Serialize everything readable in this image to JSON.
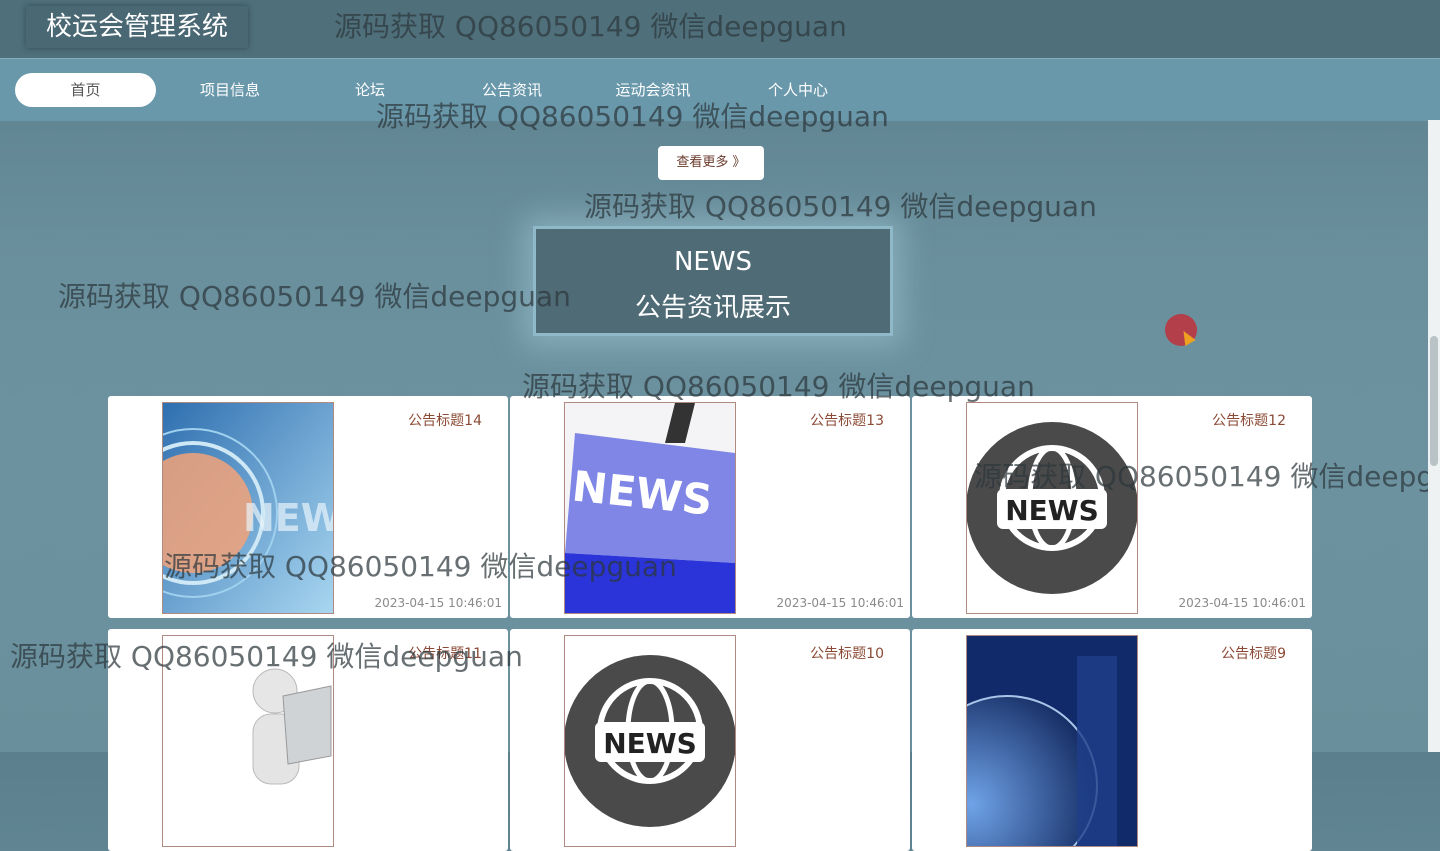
{
  "app": {
    "title": "校运会管理系统"
  },
  "nav": {
    "items": [
      {
        "label": "首页"
      },
      {
        "label": "项目信息"
      },
      {
        "label": "论坛"
      },
      {
        "label": "公告资讯"
      },
      {
        "label": "运动会资讯"
      },
      {
        "label": "个人中心"
      }
    ]
  },
  "more_button": {
    "label": "查看更多 》"
  },
  "section": {
    "title_en": "NEWS",
    "title_cn": "公告资讯展示"
  },
  "cards": [
    {
      "title": "公告标题14",
      "time": "2023-04-15 10:46:01",
      "image": "news-globe-blue"
    },
    {
      "title": "公告标题13",
      "time": "2023-04-15 10:46:01",
      "image": "news-keyboard-key"
    },
    {
      "title": "公告标题12",
      "time": "2023-04-15 10:46:01",
      "image": "news-globe-badge"
    },
    {
      "title": "公告标题11",
      "time": "",
      "image": "man-reading-newspaper"
    },
    {
      "title": "公告标题10",
      "time": "",
      "image": "news-globe-badge"
    },
    {
      "title": "公告标题9",
      "time": "",
      "image": "world-globe-news"
    }
  ],
  "watermark": {
    "text": "源码获取 QQ86050149 微信deepguan"
  },
  "colors": {
    "nav_bg": "#6a98ab",
    "topbar_bg": "#4f6f7b",
    "title_box_bg": "#4f6b76",
    "card_title": "#8b4a35"
  }
}
